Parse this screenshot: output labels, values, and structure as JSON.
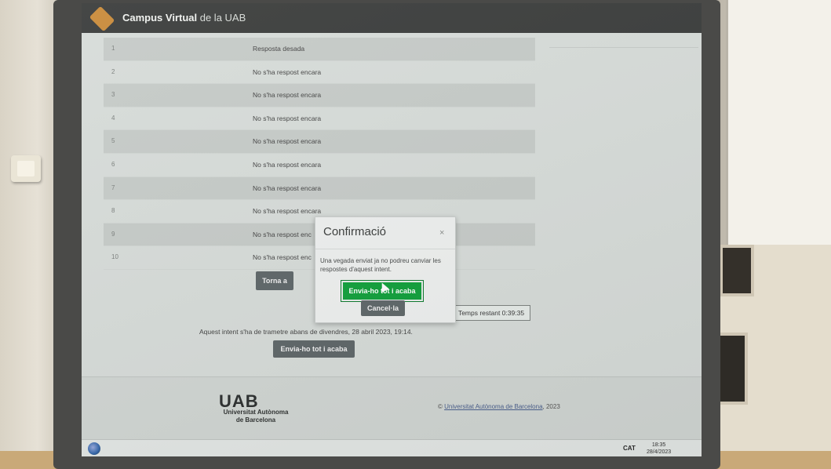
{
  "header": {
    "title_strong": "Campus Virtual",
    "title_rest": " de la UAB"
  },
  "questions": [
    {
      "num": "1",
      "status": "Resposta desada"
    },
    {
      "num": "2",
      "status": "No s'ha respost encara"
    },
    {
      "num": "3",
      "status": "No s'ha respost encara"
    },
    {
      "num": "4",
      "status": "No s'ha respost encara"
    },
    {
      "num": "5",
      "status": "No s'ha respost encara"
    },
    {
      "num": "6",
      "status": "No s'ha respost encara"
    },
    {
      "num": "7",
      "status": "No s'ha respost encara"
    },
    {
      "num": "8",
      "status": "No s'ha respost encara"
    },
    {
      "num": "9",
      "status": "No s'ha respost enc"
    },
    {
      "num": "10",
      "status": "No s'ha respost enc"
    }
  ],
  "return_button": "Torna a",
  "timer": "Temps restant 0:39:35",
  "deadline": "Aquest intent s'ha de trametre abans de divendres, 28 abril 2023, 19:14.",
  "submit_button": "Envia-ho tot i acaba",
  "modal": {
    "title": "Confirmació",
    "close": "×",
    "message": "Una vegada enviat ja no podreu canviar les respostes d'aquest intent.",
    "confirm": "Envia-ho tot i acaba",
    "cancel": "Cancel·la"
  },
  "footer": {
    "logo": "UAB",
    "name_line1": "Universitat Autònoma",
    "name_line2": "de Barcelona",
    "copyright_symbol": "© ",
    "copyright_link": "Universitat Autònoma de Barcelona",
    "copyright_year": ", 2023"
  },
  "taskbar": {
    "lang": "CAT",
    "time": "18:35",
    "date": "28/4/2023"
  }
}
